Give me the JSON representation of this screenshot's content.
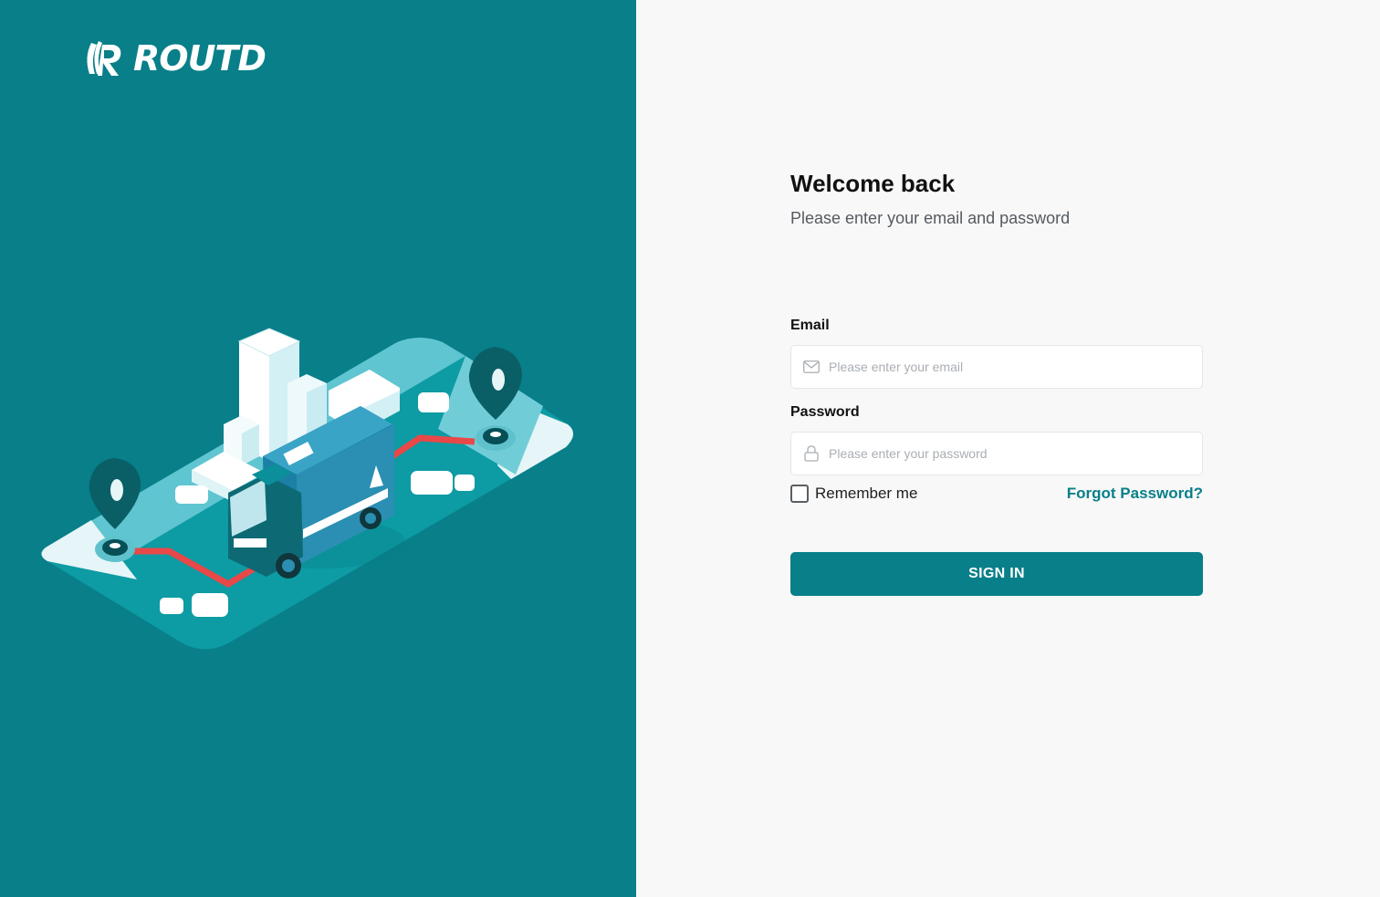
{
  "brand": {
    "name": "ROUTD",
    "colors": {
      "primary": "#087f89",
      "background": "#f8f8f8",
      "route": "#e84848"
    }
  },
  "hero": {
    "illustration": "delivery-truck-route-map-illustration"
  },
  "login": {
    "title": "Welcome back",
    "subtitle": "Please enter your email and password",
    "email": {
      "label": "Email",
      "placeholder": "Please enter your email",
      "value": "",
      "icon": "mail-icon"
    },
    "password": {
      "label": "Password",
      "placeholder": "Please enter your password",
      "value": "",
      "icon": "lock-icon"
    },
    "remember": {
      "label": "Remember me",
      "checked": false
    },
    "forgot_label": "Forgot Password?",
    "submit_label": "SIGN IN"
  }
}
